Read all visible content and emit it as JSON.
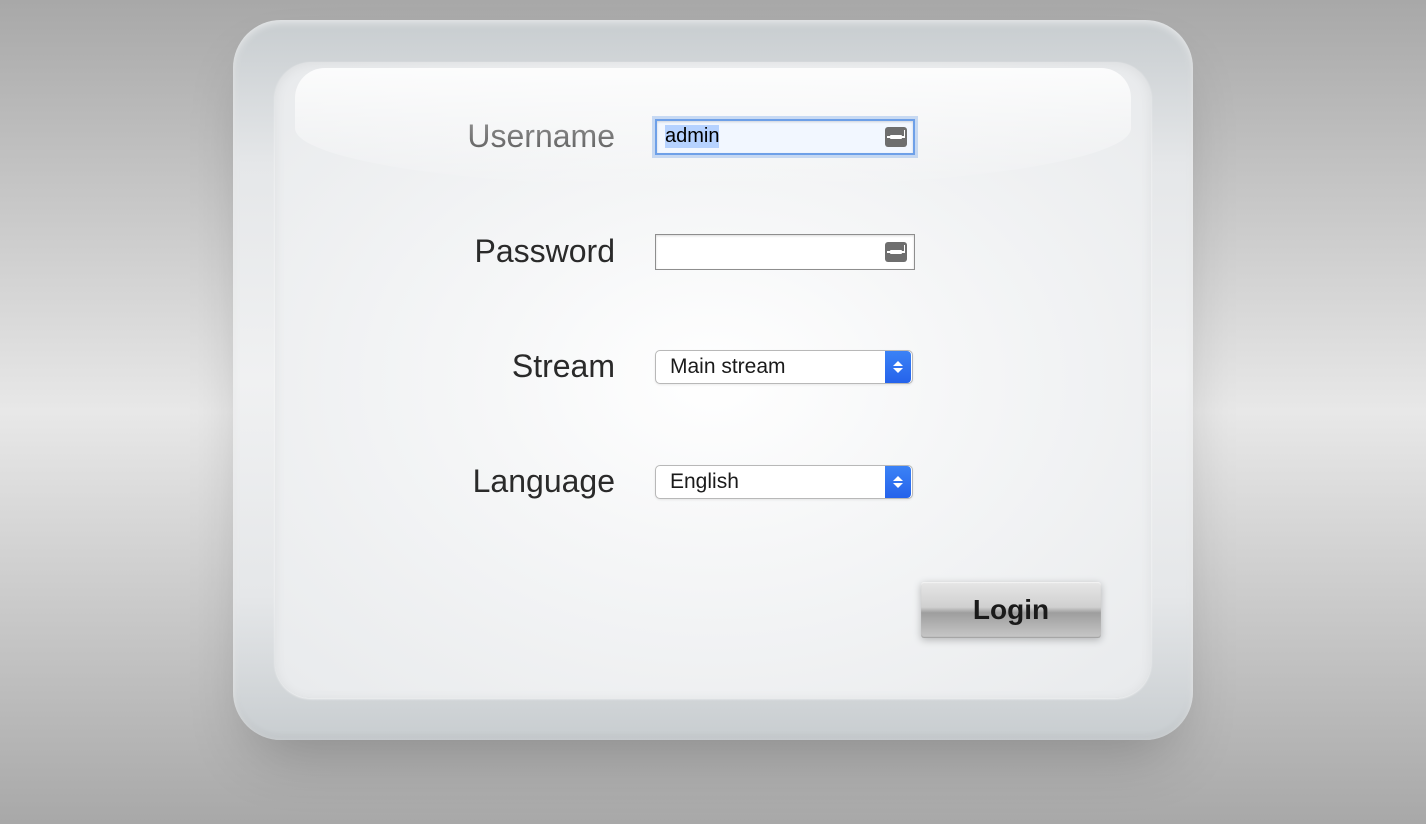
{
  "form": {
    "username": {
      "label": "Username",
      "value": "admin"
    },
    "password": {
      "label": "Password",
      "value": ""
    },
    "stream": {
      "label": "Stream",
      "value": "Main stream"
    },
    "language": {
      "label": "Language",
      "value": "English"
    },
    "login_label": "Login"
  }
}
